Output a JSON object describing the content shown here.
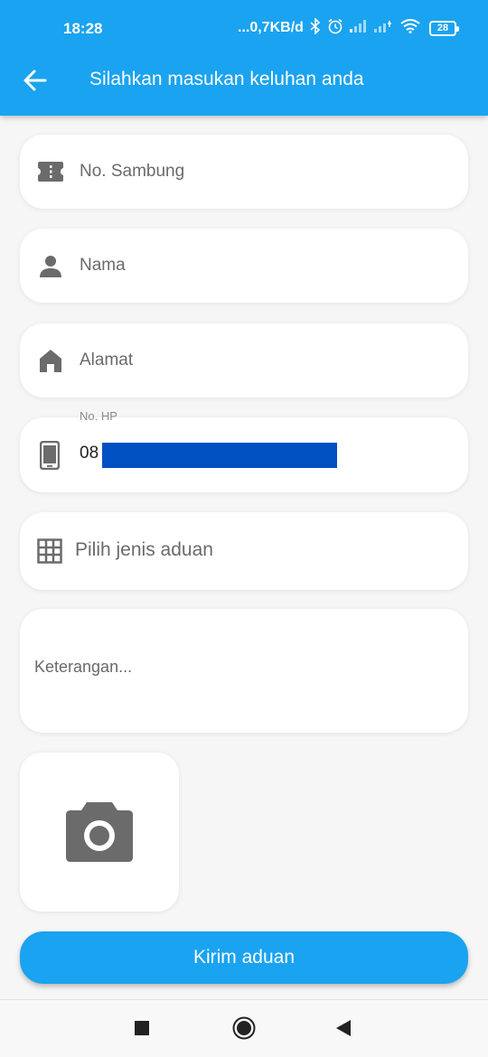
{
  "status_bar": {
    "time": "18:28",
    "network_speed": "...0,7KB/d",
    "battery": "28",
    "icons": [
      "bluetooth-icon",
      "alarm-icon",
      "signal-icon",
      "signal-icon",
      "wifi-icon",
      "battery-icon"
    ]
  },
  "appbar": {
    "title": "Silahkan masukan keluhan anda",
    "back_icon": "arrow-left-icon",
    "color": "#1aa3f0"
  },
  "form": {
    "no_sambung": {
      "placeholder": "No. Sambung",
      "icon": "ticket-icon"
    },
    "nama": {
      "placeholder": "Nama",
      "icon": "person-icon"
    },
    "alamat": {
      "placeholder": "Alamat",
      "icon": "home-icon"
    },
    "no_hp": {
      "label": "No. HP",
      "value": "08",
      "icon": "phone-icon"
    },
    "jenis_aduan": {
      "placeholder": "Pilih jenis aduan",
      "icon": "grid-icon"
    },
    "keterangan": {
      "placeholder": "Keterangan..."
    },
    "photo": {
      "icon": "camera-icon"
    }
  },
  "submit": {
    "label": "Kirim aduan"
  },
  "navbar": {
    "icons": [
      "recent-apps-icon",
      "home-button-icon",
      "back-triangle-icon"
    ]
  }
}
